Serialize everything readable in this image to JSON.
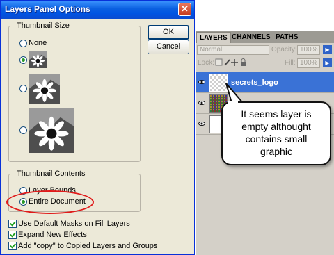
{
  "dialog": {
    "title": "Layers Panel Options",
    "close_glyph": "✕",
    "thumbnail_size": {
      "legend": "Thumbnail Size",
      "options": [
        {
          "label": "None",
          "selected": false
        },
        {
          "label": "small-thumbnail",
          "selected": true
        },
        {
          "label": "medium-thumbnail",
          "selected": false
        },
        {
          "label": "large-thumbnail",
          "selected": false
        }
      ],
      "none_label": "None"
    },
    "thumbnail_contents": {
      "legend": "Thumbnail Contents",
      "layer_bounds_label": "Layer Bounds",
      "entire_document_label": "Entire Document",
      "selected": "Entire Document"
    },
    "checkboxes": [
      {
        "label": "Use Default Masks on Fill Layers",
        "checked": true
      },
      {
        "label": "Expand New Effects",
        "checked": true
      },
      {
        "label": "Add \"copy\" to Copied Layers and Groups",
        "checked": true
      }
    ],
    "ok_label": "OK",
    "cancel_label": "Cancel",
    "highlight_color": "#e01a1a"
  },
  "layers_panel": {
    "tabs": [
      "LAYERS",
      "CHANNELS",
      "PATHS"
    ],
    "active_tab": "LAYERS",
    "blend_mode": "Normal",
    "opacity_label": "Opacity:",
    "opacity_value": "100%",
    "lock_label": "Lock:",
    "fill_label": "Fill:",
    "fill_value": "100%",
    "layers": [
      {
        "name": "secrets_logo",
        "selected": true
      },
      {
        "name": "",
        "selected": false
      },
      {
        "name": "",
        "selected": false
      }
    ],
    "selected_color": "#3a72d6"
  },
  "callout": {
    "lines": [
      "It seems layer is",
      "empty althought",
      "contains small",
      "graphic"
    ]
  }
}
